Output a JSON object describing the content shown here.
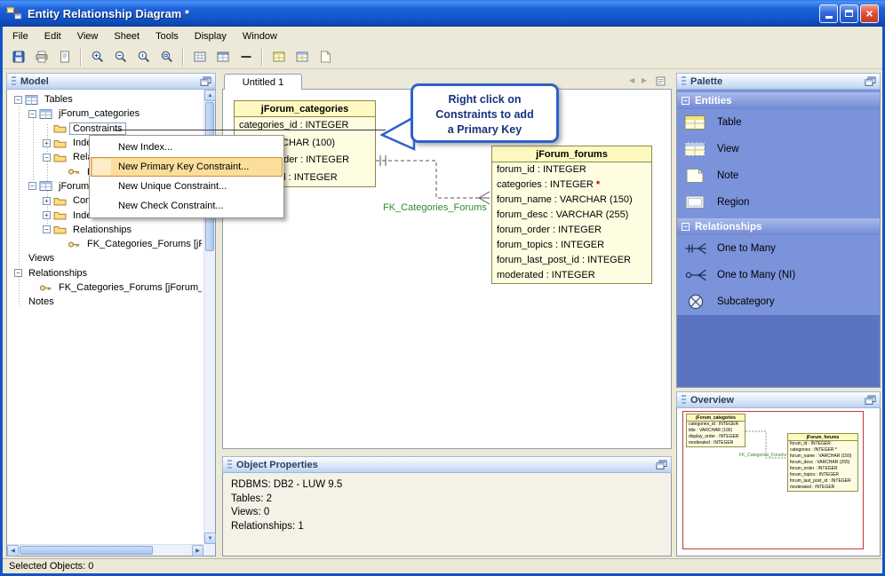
{
  "window": {
    "title": "Entity Relationship Diagram *"
  },
  "menu_bar": {
    "items": [
      "File",
      "Edit",
      "View",
      "Sheet",
      "Tools",
      "Display",
      "Window"
    ]
  },
  "toolbar": {
    "groups": [
      [
        "save",
        "print",
        "page-setup"
      ],
      [
        "zoom-in",
        "zoom-out",
        "zoom-actual",
        "zoom-fit"
      ],
      [
        "grid",
        "table-view",
        "line"
      ],
      [
        "insert-table",
        "insert-view",
        "insert-note"
      ]
    ]
  },
  "model_panel": {
    "title": "Model",
    "tree": [
      {
        "label": "Tables",
        "level": 0,
        "icon": "table-node",
        "expander": "minus"
      },
      {
        "label": "jForum_categories",
        "level": 1,
        "icon": "table-node",
        "expander": "minus"
      },
      {
        "label": "Constraints",
        "level": 2,
        "icon": "folder",
        "selected": true
      },
      {
        "label": "Indexes",
        "level": 2,
        "icon": "folder",
        "expander": "plus"
      },
      {
        "label": "Relationships",
        "level": 2,
        "icon": "folder",
        "expander": "minus"
      },
      {
        "label": "FK_Categories_Forums [jForum_categories]",
        "level": 3,
        "icon": "fk"
      },
      {
        "label": "jForum_forums",
        "level": 1,
        "icon": "table-node",
        "expander": "minus"
      },
      {
        "label": "Constraints",
        "level": 2,
        "icon": "folder",
        "expander": "plus"
      },
      {
        "label": "Indexes",
        "level": 2,
        "icon": "folder",
        "expander": "plus"
      },
      {
        "label": "Relationships",
        "level": 2,
        "icon": "folder",
        "expander": "minus"
      },
      {
        "label": "FK_Categories_Forums [jForum_categories]",
        "level": 3,
        "icon": "fk"
      },
      {
        "label": "Views",
        "level": 0
      },
      {
        "label": "Relationships",
        "level": 0,
        "expander": "minus"
      },
      {
        "label": "FK_Categories_Forums [jForum_categories]",
        "level": 1,
        "icon": "fk"
      },
      {
        "label": "Notes",
        "level": 0
      }
    ]
  },
  "context_menu": {
    "items": [
      {
        "label": "New Index...",
        "highlighted": false
      },
      {
        "label": "New Primary Key Constraint...",
        "highlighted": true
      },
      {
        "label": "New Unique Constraint...",
        "highlighted": false
      },
      {
        "label": "New Check Constraint...",
        "highlighted": false
      }
    ]
  },
  "editor": {
    "tab": "Untitled 1"
  },
  "callout": {
    "lines": [
      "Right click on",
      "Constraints to add",
      "a Primary Key"
    ]
  },
  "diagram": {
    "tables": [
      {
        "name": "jForum_categories",
        "columns": [
          {
            "text": "categories_id : INTEGER"
          },
          {
            "text": "title : VARCHAR (100)"
          },
          {
            "text": "display_order : INTEGER"
          },
          {
            "text": "moderated : INTEGER"
          }
        ]
      },
      {
        "name": "jForum_forums",
        "columns": [
          {
            "text": "forum_id : INTEGER"
          },
          {
            "text": "categories : INTEGER",
            "required": true
          },
          {
            "text": "forum_name : VARCHAR (150)"
          },
          {
            "text": "forum_desc : VARCHAR (255)"
          },
          {
            "text": "forum_order : INTEGER"
          },
          {
            "text": "forum_topics : INTEGER"
          },
          {
            "text": "forum_last_post_id : INTEGER"
          },
          {
            "text": "moderated : INTEGER"
          }
        ]
      }
    ],
    "relationship_label": "FK_Categories_Forums"
  },
  "object_properties": {
    "title": "Object Properties",
    "lines": [
      "RDBMS: DB2 - LUW 9.5",
      "Tables: 2",
      "Views: 0",
      "Relationships: 1"
    ]
  },
  "palette": {
    "title": "Palette",
    "sections": [
      {
        "label": "Entities",
        "items": [
          {
            "label": "Table",
            "icon": "table"
          },
          {
            "label": "View",
            "icon": "view"
          },
          {
            "label": "Note",
            "icon": "note"
          },
          {
            "label": "Region",
            "icon": "region"
          }
        ]
      },
      {
        "label": "Relationships",
        "items": [
          {
            "label": "One to Many",
            "icon": "one-to-many"
          },
          {
            "label": "One to Many (NI)",
            "icon": "one-to-many-ni"
          },
          {
            "label": "Subcategory",
            "icon": "subcategory"
          }
        ]
      }
    ]
  },
  "overview": {
    "title": "Overview"
  },
  "status_bar": {
    "text": "Selected Objects: 0"
  },
  "colors": {
    "highlight_orange": "#FBDD9C",
    "callout_blue": "#2E62C9",
    "table_fill": "#FFFDE1",
    "relationship_green": "#2E8B2E",
    "palette_blue": "#7B93DB",
    "viewport_red": "#C23A3A"
  }
}
